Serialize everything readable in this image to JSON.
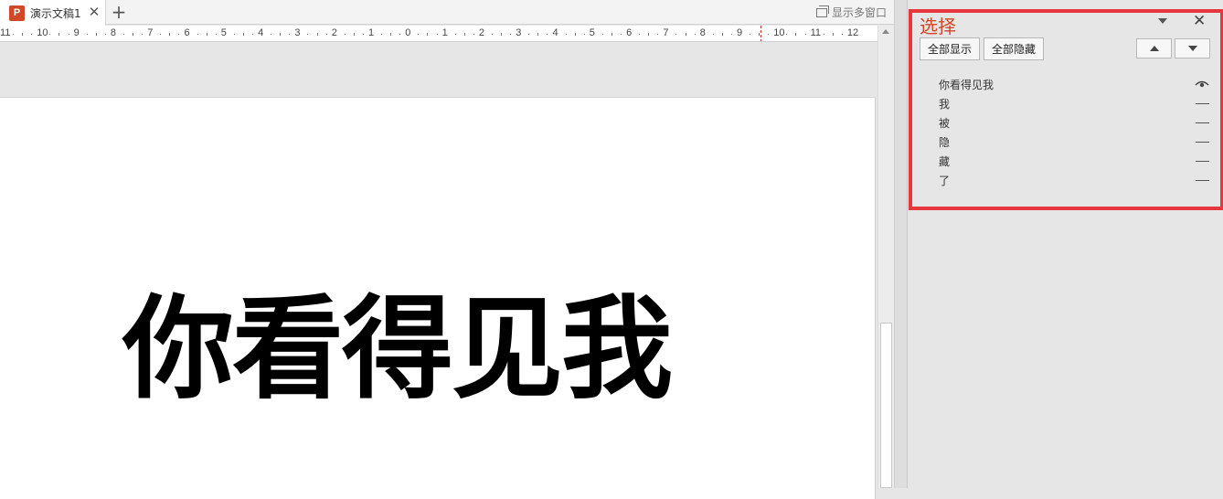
{
  "tab": {
    "app_icon_letter": "P",
    "title": "演示文稿1",
    "close_glyph": "✕",
    "new_glyph": "+"
  },
  "toolbar_right": {
    "multi_window_label": "显示多窗口"
  },
  "ruler": {
    "labels": [
      "11",
      "10",
      "9",
      "8",
      "7",
      "6",
      "5",
      "4",
      "3",
      "2",
      "1",
      "0",
      "1",
      "2",
      "3",
      "4",
      "5",
      "6",
      "7",
      "8",
      "9",
      "10",
      "11",
      "12"
    ]
  },
  "slide": {
    "text": "你看得见我"
  },
  "selection_pane": {
    "title": "选择",
    "show_all_label": "全部显示",
    "hide_all_label": "全部隐藏",
    "close_glyph": "✕",
    "items": [
      {
        "label": "你看得见我",
        "visible": true
      },
      {
        "label": "我",
        "visible": false
      },
      {
        "label": "被",
        "visible": false
      },
      {
        "label": "隐",
        "visible": false
      },
      {
        "label": "藏",
        "visible": false
      },
      {
        "label": "了",
        "visible": false
      }
    ]
  },
  "colors": {
    "accent": "#d24726",
    "highlight_border": "#e8363d"
  }
}
